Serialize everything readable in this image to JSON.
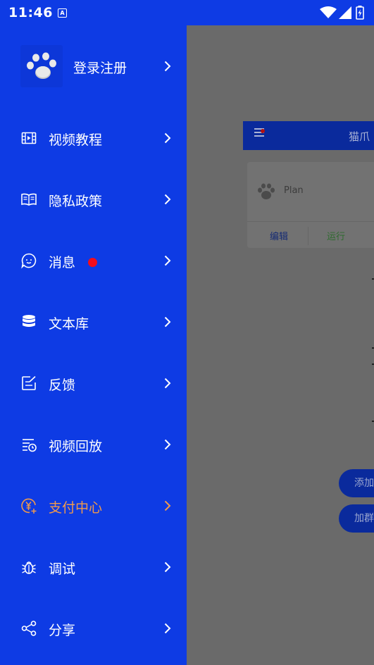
{
  "status_bar": {
    "time": "11:46",
    "notification_icon": "A"
  },
  "drawer": {
    "header": {
      "login_label": "登录注册"
    },
    "items": [
      {
        "label": "视频教程",
        "icon": "film-icon"
      },
      {
        "label": "隐私政策",
        "icon": "book-icon"
      },
      {
        "label": "消息",
        "icon": "chat-icon",
        "badge": true
      },
      {
        "label": "文本库",
        "icon": "database-icon"
      },
      {
        "label": "反馈",
        "icon": "edit-icon"
      },
      {
        "label": "视频回放",
        "icon": "playlist-clock-icon"
      },
      {
        "label": "支付中心",
        "icon": "yen-icon",
        "active": true
      },
      {
        "label": "调试",
        "icon": "bug-icon"
      },
      {
        "label": "分享",
        "icon": "share-icon"
      }
    ],
    "colors": {
      "background": "#0e3be4",
      "active": "#f09a4c",
      "badge": "#f20d1c"
    }
  },
  "background_app": {
    "toolbar_title": "猫爪",
    "card": {
      "title": "Plan",
      "edit_label": "编辑",
      "run_label": "运行"
    },
    "fab_add": "添加",
    "fab_join": "加群"
  }
}
